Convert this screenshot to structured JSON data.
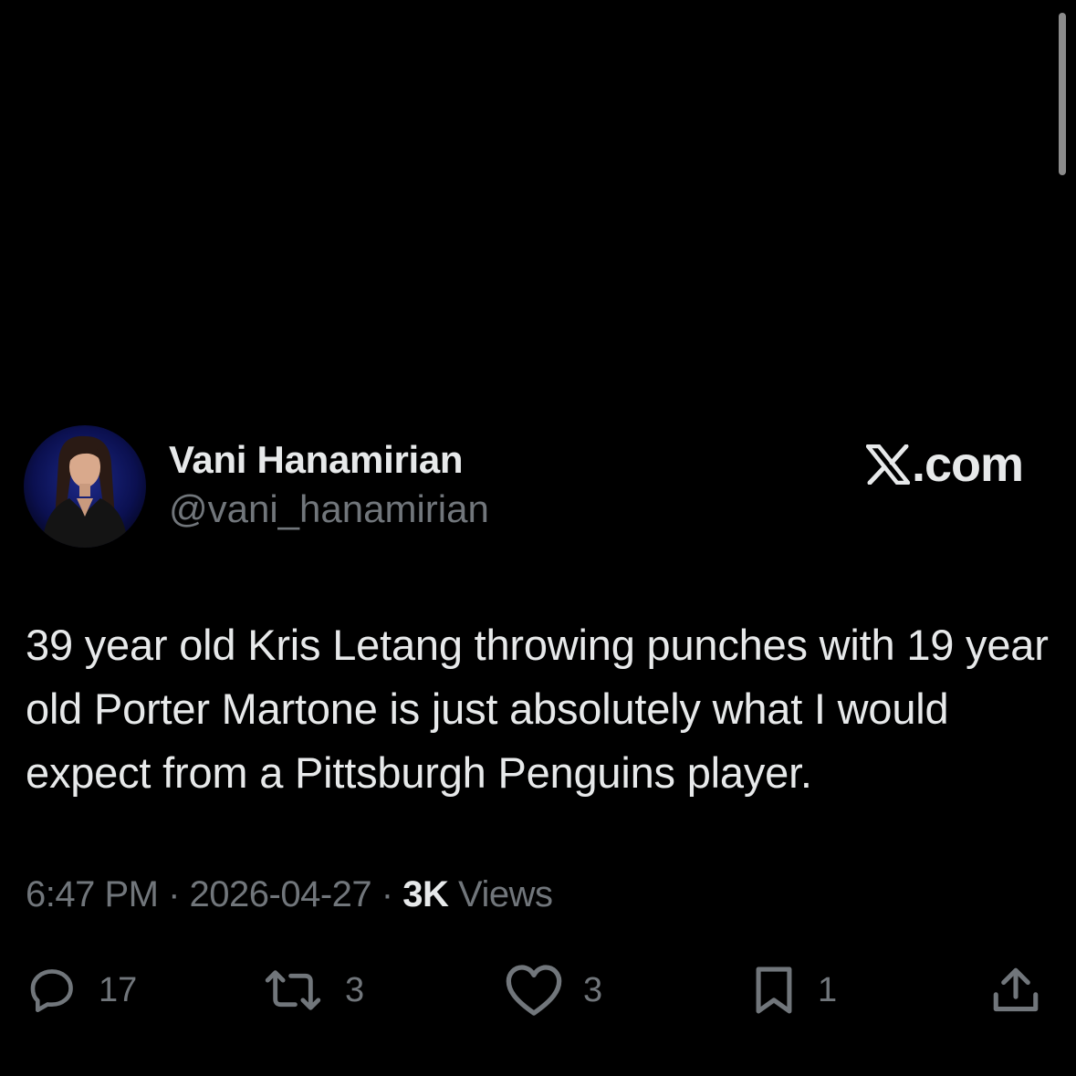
{
  "author": {
    "display_name": "Vani Hanamirian",
    "handle": "@vani_hanamirian"
  },
  "brand": {
    "icon": "x-logo-icon",
    "label": ".com"
  },
  "tweet": {
    "text": "39 year old Kris Letang throwing punches with 19 year old Porter Martone is just absolutely what I would expect from a Pittsburgh Penguins player."
  },
  "meta": {
    "time": "6:47 PM",
    "separator": "·",
    "date": "2026-04-27",
    "views_count": "3K",
    "views_label": "Views"
  },
  "actions": {
    "replies": {
      "icon": "reply-icon",
      "count": "17"
    },
    "reposts": {
      "icon": "repost-icon",
      "count": "3"
    },
    "likes": {
      "icon": "heart-icon",
      "count": "3"
    },
    "bookmarks": {
      "icon": "bookmark-icon",
      "count": "1"
    },
    "share": {
      "icon": "share-icon"
    }
  },
  "colors": {
    "background": "#000000",
    "primary_text": "#e7e9ea",
    "secondary_text": "#71767b"
  }
}
